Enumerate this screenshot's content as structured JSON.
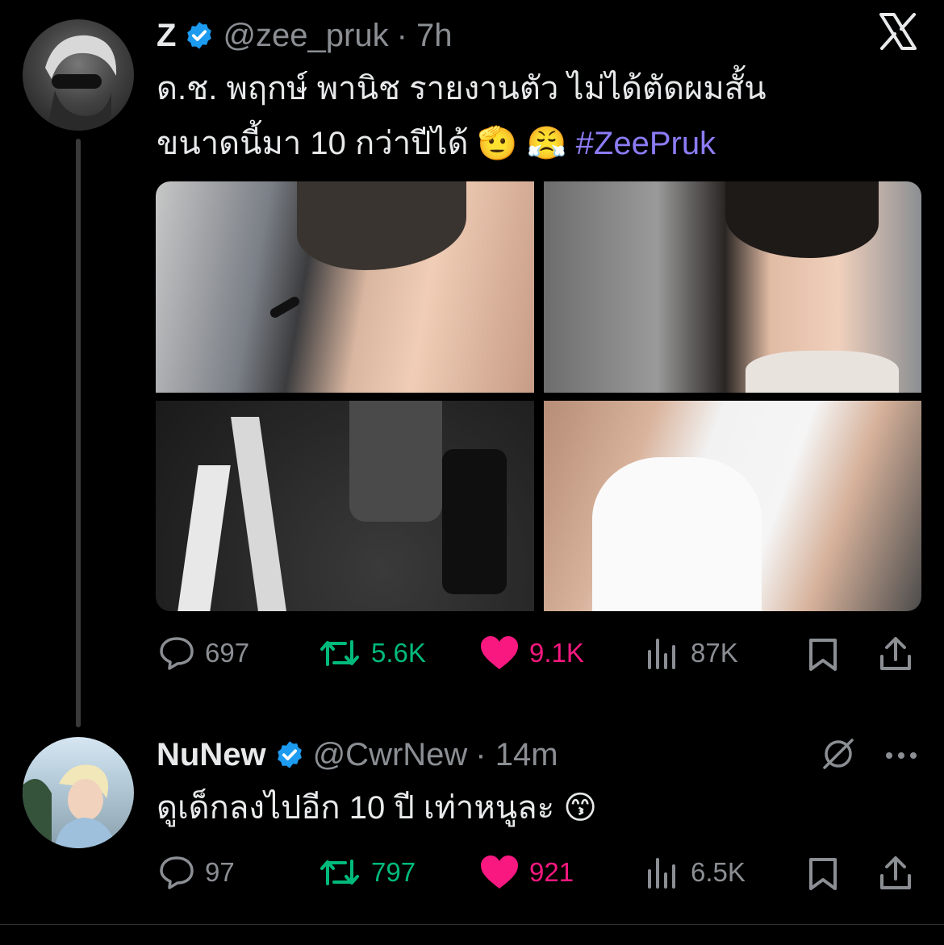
{
  "colors": {
    "background": "#000000",
    "text": "#e7e9ea",
    "muted": "#8b8f94",
    "hashtag": "#8b7cf6",
    "retweet": "#00ba7c",
    "like": "#f91880",
    "verified": "#1d9bf0"
  },
  "close_icon": "x-logo-icon",
  "tweet1": {
    "author_name": "Z",
    "author_handle": "@zee_pruk",
    "time": "· 7h",
    "text_line1": "ด.ช. พฤกษ์ พานิช รายงานตัว ไม่ได้ตัดผมสั้น",
    "text_line2": "ขนาดนี้มา 10 กว่าปีได้",
    "emoji1": "🫡",
    "emoji2": "😤",
    "hashtag": "#ZeePruk",
    "stats": {
      "replies": "697",
      "retweets": "5.6K",
      "likes": "9.1K",
      "views": "87K"
    }
  },
  "tweet2": {
    "author_name": "NuNew",
    "author_handle": "@CwrNew",
    "time": "· 14m",
    "text": "ดูเด็กลงไปอีก 10 ปี เท่าหนูละ",
    "emoji": "😙",
    "stats": {
      "replies": "97",
      "retweets": "797",
      "likes": "921",
      "views": "6.5K"
    }
  }
}
